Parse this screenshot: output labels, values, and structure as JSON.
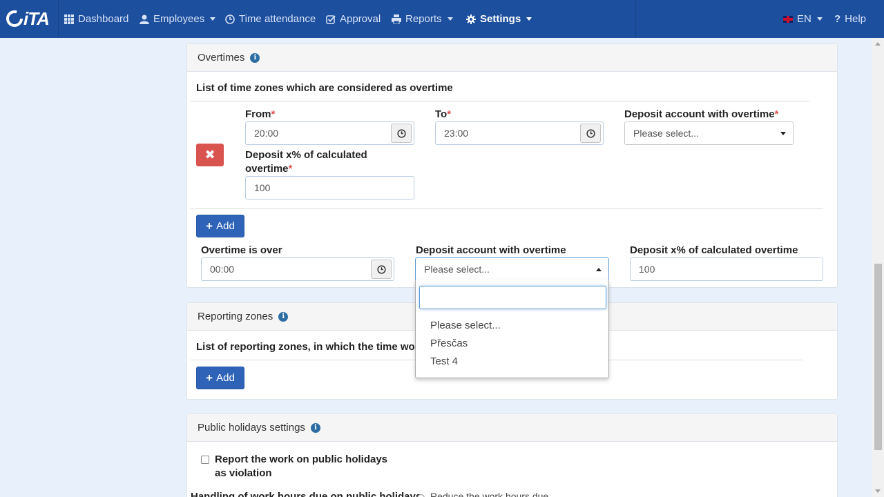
{
  "nav": {
    "brand": "iTA",
    "items": [
      {
        "label": "Dashboard",
        "icon": "grid-icon"
      },
      {
        "label": "Employees",
        "icon": "user-icon"
      },
      {
        "label": "Time attendance",
        "icon": "clock-icon"
      },
      {
        "label": "Approval",
        "icon": "check-square-icon"
      },
      {
        "label": "Reports",
        "icon": "print-icon"
      },
      {
        "label": "Settings",
        "icon": "gear-icon"
      }
    ],
    "language": "EN",
    "help": "Help"
  },
  "overtimes": {
    "heading": "Overtimes",
    "list_title": "List of time zones which are considered as overtime",
    "from_label": "From",
    "from_value": "20:00",
    "to_label": "To",
    "to_value": "23:00",
    "deposit_account_label": "Deposit account with overtime",
    "deposit_account_value": "Please select...",
    "deposit_pct_label_line1": "Deposit x% of calculated",
    "deposit_pct_label_line2": "overtime",
    "deposit_pct_value": "100",
    "required_mark": "*",
    "add_label": "Add",
    "over_label": "Overtime is over",
    "over_value": "00:00",
    "over_deposit_label": "Deposit account with overtime",
    "over_deposit_value": "Please select...",
    "over_pct_label": "Deposit x% of calculated overtime",
    "over_pct_value": "100"
  },
  "dropdown": {
    "search_value": "",
    "options": [
      "Please select...",
      "Přesčas",
      "Test 4"
    ]
  },
  "reporting": {
    "heading": "Reporting zones",
    "list_title": "List of reporting zones, in which the time wor",
    "add_label": "Add"
  },
  "holidays": {
    "heading": "Public holidays settings",
    "report_label_line1": "Report the work on public holidays",
    "report_label_line2": "as violation",
    "handling_label": "Handling of work hours due on public holidays",
    "handling_option": "Reduce the work hours due"
  },
  "colors": {
    "navbar": "#1d4f9f",
    "primary_button": "#2f63b8",
    "danger_button": "#d9534f",
    "page_background": "#e8f1fb"
  }
}
